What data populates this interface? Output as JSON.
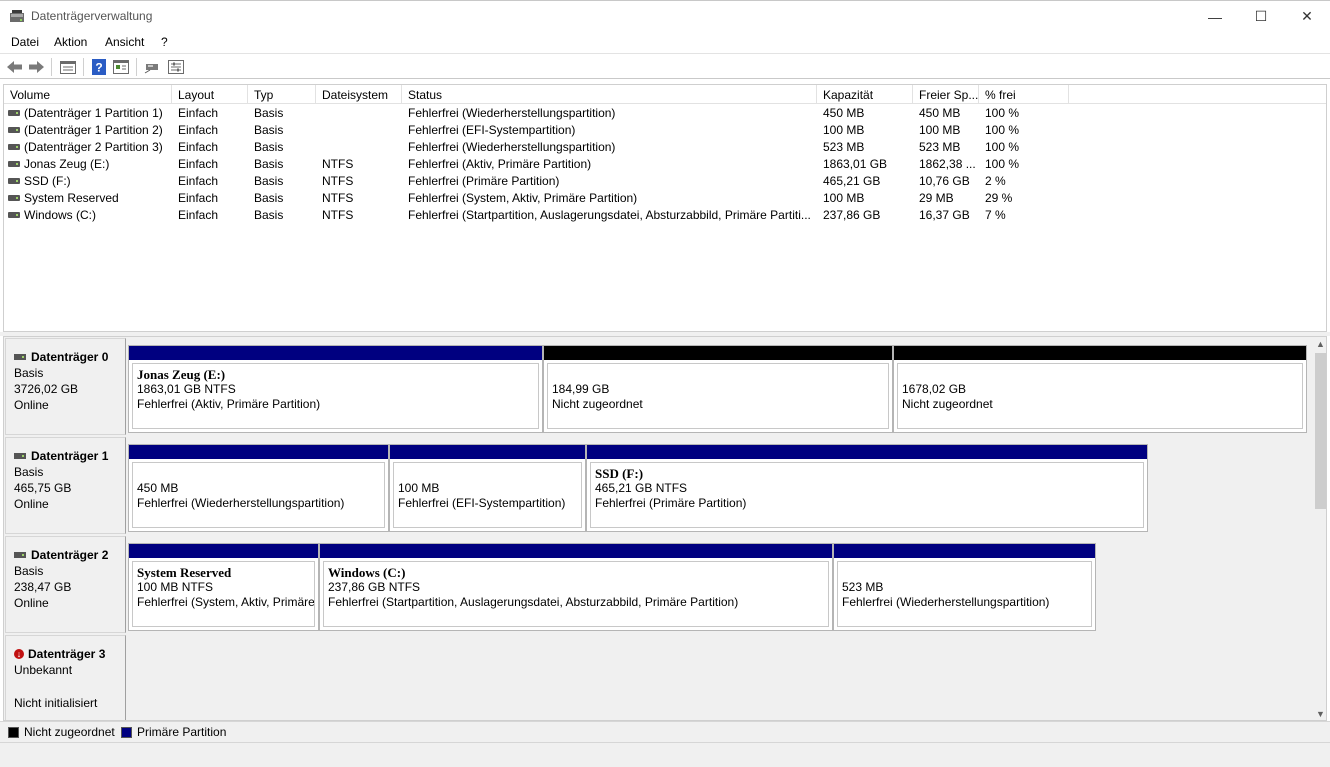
{
  "window": {
    "title": "Datenträgerverwaltung",
    "minimize_glyph": "—",
    "maximize_glyph": "☐",
    "close_glyph": "✕"
  },
  "menu": {
    "items": [
      "Datei",
      "Aktion",
      "Ansicht",
      "?"
    ]
  },
  "toolbar": {
    "icons": [
      "back-arrow-icon",
      "forward-arrow-icon",
      "disk-list-icon",
      "help-icon",
      "properties-icon",
      "connect-icon",
      "settings-icon"
    ]
  },
  "volume_list": {
    "columns": [
      "Volume",
      "Layout",
      "Typ",
      "Dateisystem",
      "Status",
      "Kapazität",
      "Freier Sp...",
      "% frei"
    ],
    "rows": [
      [
        "(Datenträger 1 Partition 1)",
        "Einfach",
        "Basis",
        "",
        "Fehlerfrei (Wiederherstellungspartition)",
        "450 MB",
        "450 MB",
        "100 %"
      ],
      [
        "(Datenträger 1 Partition 2)",
        "Einfach",
        "Basis",
        "",
        "Fehlerfrei (EFI-Systempartition)",
        "100 MB",
        "100 MB",
        "100 %"
      ],
      [
        "(Datenträger 2 Partition 3)",
        "Einfach",
        "Basis",
        "",
        "Fehlerfrei (Wiederherstellungspartition)",
        "523 MB",
        "523 MB",
        "100 %"
      ],
      [
        "Jonas Zeug (E:)",
        "Einfach",
        "Basis",
        "NTFS",
        "Fehlerfrei (Aktiv, Primäre Partition)",
        "1863,01 GB",
        "1862,38 ...",
        "100 %"
      ],
      [
        "SSD (F:)",
        "Einfach",
        "Basis",
        "NTFS",
        "Fehlerfrei (Primäre Partition)",
        "465,21 GB",
        "10,76 GB",
        "2 %"
      ],
      [
        "System Reserved",
        "Einfach",
        "Basis",
        "NTFS",
        "Fehlerfrei (System, Aktiv, Primäre Partition)",
        "100 MB",
        "29 MB",
        "29 %"
      ],
      [
        "Windows (C:)",
        "Einfach",
        "Basis",
        "NTFS",
        "Fehlerfrei (Startpartition, Auslagerungsdatei, Absturzabbild, Primäre Partiti...",
        "237,86 GB",
        "16,37 GB",
        "7 %"
      ]
    ]
  },
  "disks": [
    {
      "name": "Datenträger 0",
      "type": "Basis",
      "size": "3726,02 GB",
      "state": "Online",
      "partitions": [
        {
          "kind": "primary",
          "name": "Jonas Zeug  (E:)",
          "size": "1863,01 GB NTFS",
          "status": "Fehlerfrei (Aktiv, Primäre Partition)"
        },
        {
          "kind": "unalloc",
          "name": "",
          "size": "184,99 GB",
          "status": "Nicht zugeordnet"
        },
        {
          "kind": "unalloc",
          "name": "",
          "size": "1678,02 GB",
          "status": "Nicht zugeordnet"
        }
      ]
    },
    {
      "name": "Datenträger 1",
      "type": "Basis",
      "size": "465,75 GB",
      "state": "Online",
      "partitions": [
        {
          "kind": "primary",
          "name": "",
          "size": "450 MB",
          "status": "Fehlerfrei (Wiederherstellungspartition)"
        },
        {
          "kind": "primary",
          "name": "",
          "size": "100 MB",
          "status": "Fehlerfrei (EFI-Systempartition)"
        },
        {
          "kind": "primary",
          "name": "SSD  (F:)",
          "size": "465,21 GB NTFS",
          "status": "Fehlerfrei (Primäre Partition)"
        }
      ]
    },
    {
      "name": "Datenträger 2",
      "type": "Basis",
      "size": "238,47 GB",
      "state": "Online",
      "partitions": [
        {
          "kind": "primary",
          "name": "System Reserved",
          "size": "100 MB NTFS",
          "status": "Fehlerfrei (System, Aktiv, Primäre"
        },
        {
          "kind": "primary",
          "name": "Windows  (C:)",
          "size": "237,86 GB NTFS",
          "status": "Fehlerfrei (Startpartition, Auslagerungsdatei, Absturzabbild, Primäre Partition)"
        },
        {
          "kind": "primary",
          "name": "",
          "size": "523 MB",
          "status": "Fehlerfrei (Wiederherstellungspartition)"
        }
      ]
    },
    {
      "name": "Datenträger 3",
      "type": "Unbekannt",
      "size": "",
      "state": "Nicht initialisiert",
      "partitions": []
    }
  ],
  "legend": {
    "unallocated_label": "Nicht zugeordnet",
    "primary_label": "Primäre Partition",
    "unallocated_color": "#000000",
    "primary_color": "#000080"
  },
  "colors": {
    "primary_bar": "#000080",
    "unallocated_bar": "#000000",
    "panel_bg": "#f0f0f0"
  }
}
